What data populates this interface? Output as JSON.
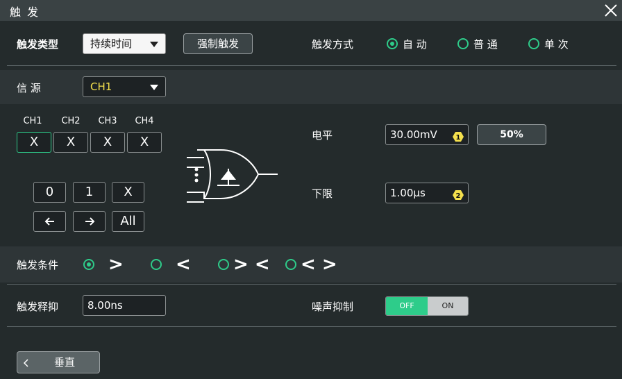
{
  "window": {
    "title": "触 发"
  },
  "trigger_type": {
    "label": "触发类型",
    "value": "持续时间"
  },
  "force_trigger": {
    "label": "强制触发"
  },
  "sweep": {
    "label": "触发方式",
    "options": [
      {
        "label": "自 动",
        "selected": true
      },
      {
        "label": "普 通",
        "selected": false
      },
      {
        "label": "单 次",
        "selected": false
      }
    ]
  },
  "source": {
    "label": "信 源",
    "value": "CH1"
  },
  "channels": [
    {
      "name": "CH1",
      "value": "X"
    },
    {
      "name": "CH2",
      "value": "X"
    },
    {
      "name": "CH3",
      "value": "X"
    },
    {
      "name": "CH4",
      "value": "X"
    }
  ],
  "keys": {
    "zero": "0",
    "one": "1",
    "x": "X",
    "all": "All"
  },
  "level": {
    "label": "电平",
    "value": "30.00mV",
    "badge": "1",
    "preset": "50%"
  },
  "lower_limit": {
    "label": "下限",
    "value": "1.00µs",
    "badge": "2"
  },
  "condition": {
    "label": "触发条件",
    "options": [
      {
        "symbol": ">",
        "selected": true
      },
      {
        "symbol": "<",
        "selected": false
      },
      {
        "symbol": "> <",
        "selected": false
      },
      {
        "symbol": "< >",
        "selected": false
      }
    ]
  },
  "holdoff": {
    "label": "触发释抑",
    "value": "8.00ns"
  },
  "noise_reject": {
    "label": "噪声抑制",
    "off": "OFF",
    "on": "ON"
  },
  "back": {
    "label": "垂直"
  },
  "colors": {
    "accent": "#2ecc8a",
    "badge": "#f4e04d",
    "source_text": "#f4e04d"
  }
}
